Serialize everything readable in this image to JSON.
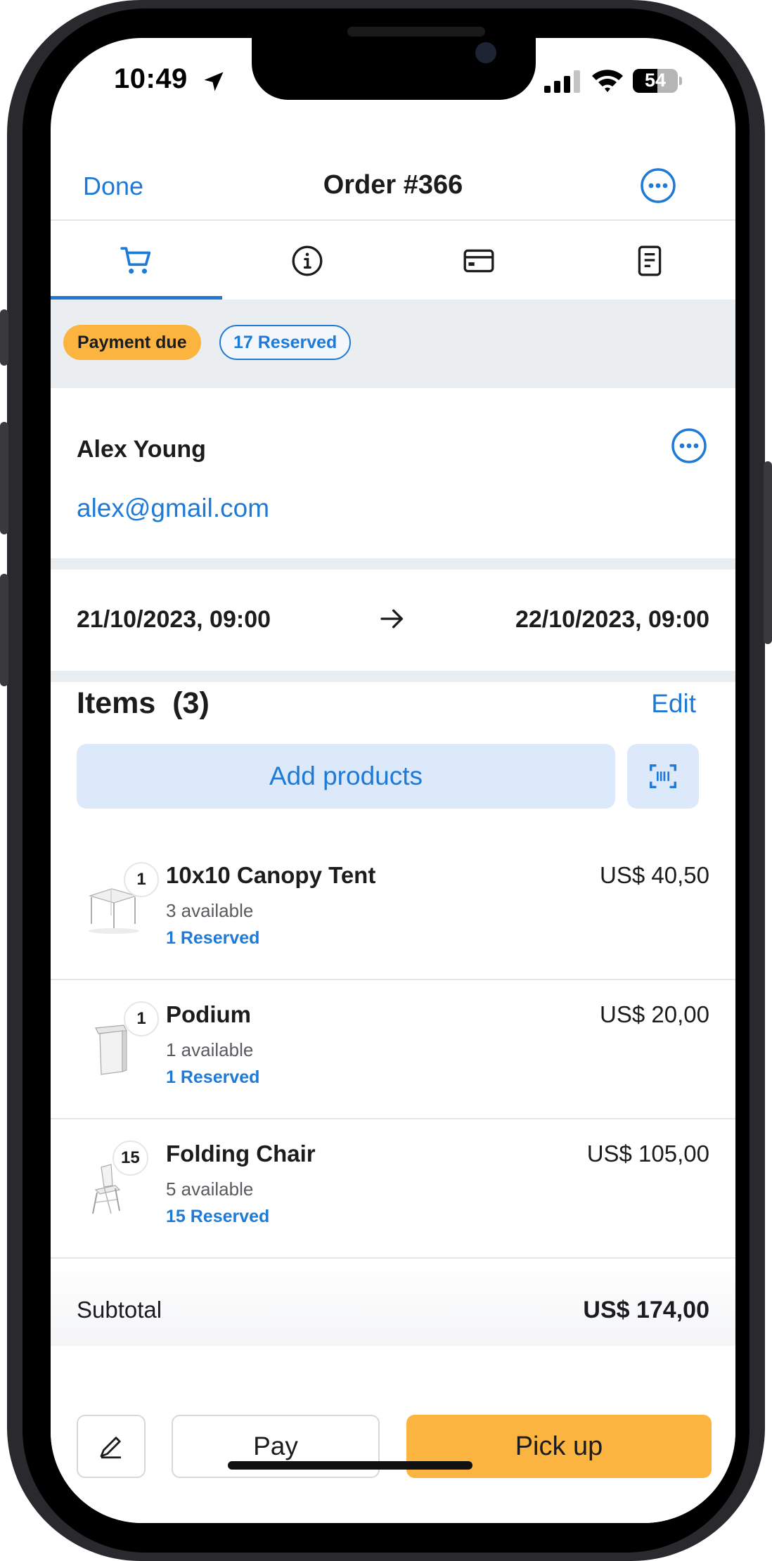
{
  "status_bar": {
    "time": "10:49",
    "battery": "54",
    "battery_level": 0.54,
    "icons": [
      "location-arrow-icon",
      "cellular-signal-icon",
      "wifi-icon",
      "battery-icon"
    ]
  },
  "nav": {
    "done_label": "Done",
    "title": "Order #366",
    "more_icon": "more-circle-icon"
  },
  "tabs": [
    {
      "icon": "cart-icon",
      "active": true
    },
    {
      "icon": "info-icon",
      "active": false
    },
    {
      "icon": "credit-card-icon",
      "active": false
    },
    {
      "icon": "document-icon",
      "active": false
    }
  ],
  "badges": {
    "payment": "Payment due",
    "reserved": "17 Reserved"
  },
  "customer": {
    "name": "Alex Young",
    "email": "alex@gmail.com"
  },
  "dates": {
    "start": "21/10/2023, 09:00",
    "end": "22/10/2023, 09:00"
  },
  "items_section": {
    "title": "Items  (3)",
    "edit_label": "Edit",
    "add_products_label": "Add products",
    "scan_icon": "barcode-scan-icon"
  },
  "items": [
    {
      "qty": "1",
      "name": "10x10 Canopy Tent",
      "available": "3 available",
      "reserved": "1 Reserved",
      "price": "US$ 40,50",
      "thumb": "canopy-tent-image"
    },
    {
      "qty": "1",
      "name": "Podium",
      "available": "1 available",
      "reserved": "1 Reserved",
      "price": "US$ 20,00",
      "thumb": "podium-image"
    },
    {
      "qty": "15",
      "name": "Folding Chair",
      "available": "5 available",
      "reserved": "15 Reserved",
      "price": "US$ 105,00",
      "thumb": "folding-chair-image"
    }
  ],
  "subtotal": {
    "label": "Subtotal",
    "value": "US$ 174,00"
  },
  "actions": {
    "edit_icon": "pencil-icon",
    "pay_label": "Pay",
    "pickup_label": "Pick up"
  },
  "colors": {
    "accent": "#1f7ad6",
    "warning": "#fbb440",
    "band": "#ebeef1"
  }
}
